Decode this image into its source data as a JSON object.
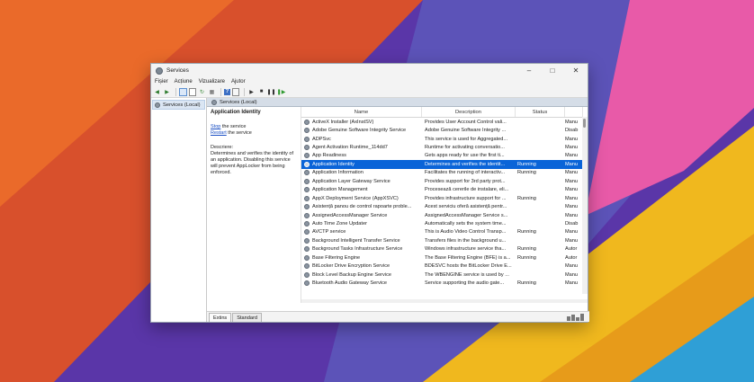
{
  "window": {
    "title": "Services"
  },
  "menu": [
    "Fișier",
    "Acțiune",
    "Vizualizare",
    "Ajutor"
  ],
  "tree": {
    "root": "Services (Local)"
  },
  "pane": {
    "header": "Services (Local)",
    "selected_title": "Application Identity",
    "stop_link": "Stop",
    "stop_rest": " the service",
    "restart_link": "Restart",
    "restart_rest": " the service",
    "desc_label": "Descriere:",
    "desc_text": "Determines and verifies the identity of an application. Disabling this service will prevent AppLocker from being enforced."
  },
  "columns": {
    "name": "Name",
    "description": "Description",
    "status": "Status",
    "startup": ""
  },
  "services": [
    {
      "name": "ActiveX Installer (AxInstSV)",
      "description": "Provides User Account Control vali...",
      "status": "",
      "startup": "Manu"
    },
    {
      "name": "Adobe Genuine Software Integrity Service",
      "description": "Adobe Genuine Software Integrity ...",
      "status": "",
      "startup": "Disab"
    },
    {
      "name": "ADPSvc",
      "description": "This service is used for Aggregated...",
      "status": "",
      "startup": "Manu"
    },
    {
      "name": "Agent Activation Runtime_114dd7",
      "description": "Runtime for activating conversatio...",
      "status": "",
      "startup": "Manu"
    },
    {
      "name": "App Readiness",
      "description": "Gets apps ready for use the first ti...",
      "status": "",
      "startup": "Manu"
    },
    {
      "name": "Application Identity",
      "description": "Determines and verifies the identit...",
      "status": "Running",
      "startup": "Manu"
    },
    {
      "name": "Application Information",
      "description": "Facilitates the running of interactiv...",
      "status": "Running",
      "startup": "Manu"
    },
    {
      "name": "Application Layer Gateway Service",
      "description": "Provides support for 3rd party prot...",
      "status": "",
      "startup": "Manu"
    },
    {
      "name": "Application Management",
      "description": "Procesează cererile de instalare, eli...",
      "status": "",
      "startup": "Manu"
    },
    {
      "name": "AppX Deployment Service (AppXSVC)",
      "description": "Provides infrastructure support for ...",
      "status": "Running",
      "startup": "Manu"
    },
    {
      "name": "Asistență panou de control rapoarte proble...",
      "description": "Acest serviciu oferă asistență pentr...",
      "status": "",
      "startup": "Manu"
    },
    {
      "name": "AssignedAccessManager Service",
      "description": "AssignedAccessManager Service s...",
      "status": "",
      "startup": "Manu"
    },
    {
      "name": "Auto Time Zone Updater",
      "description": "Automatically sets the system time...",
      "status": "",
      "startup": "Disab"
    },
    {
      "name": "AVCTP service",
      "description": "This is Audio Video Control Transp...",
      "status": "Running",
      "startup": "Manu"
    },
    {
      "name": "Background Intelligent Transfer Service",
      "description": "Transfers files in the background u...",
      "status": "",
      "startup": "Manu"
    },
    {
      "name": "Background Tasks Infrastructure Service",
      "description": "Windows infrastructure service tha...",
      "status": "Running",
      "startup": "Autor"
    },
    {
      "name": "Base Filtering Engine",
      "description": "The Base Filtering Engine (BFE) is a...",
      "status": "Running",
      "startup": "Autor"
    },
    {
      "name": "BitLocker Drive Encryption Service",
      "description": "BDESVC hosts the BitLocker Drive E...",
      "status": "",
      "startup": "Manu"
    },
    {
      "name": "Block Level Backup Engine Service",
      "description": "The WBENGINE service is used by ...",
      "status": "",
      "startup": "Manu"
    },
    {
      "name": "Bluetooth Audio Gateway Service",
      "description": "Service supporting the audio gate...",
      "status": "Running",
      "startup": "Manu"
    }
  ],
  "selected_index": 5,
  "tabs": [
    "Extins",
    "Standard"
  ],
  "colors": {
    "selection": "#0a64d8",
    "link": "#1a4fc4"
  }
}
